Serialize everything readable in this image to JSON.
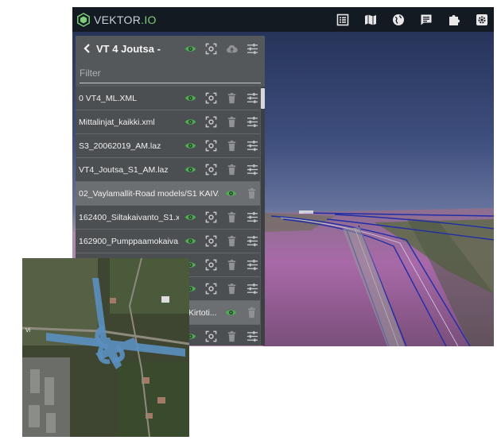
{
  "app": {
    "brand": {
      "name": "VEKTOR",
      "suffix": ".IO"
    },
    "top_icons": [
      "table-icon",
      "map-icon",
      "globe-icon",
      "notes-icon",
      "puzzle-icon",
      "settings-icon"
    ]
  },
  "panel": {
    "title": "VT 4 Joutsa -",
    "header_icons": [
      "eye-icon",
      "focus-icon",
      "cloud-upload-icon",
      "sliders-icon"
    ],
    "filter_placeholder": "Filter",
    "layers": [
      {
        "label": "0 VT4_ML.XML",
        "icons": [
          "eye-icon",
          "focus-icon",
          "trash-icon",
          "sliders-icon"
        ],
        "selected": false
      },
      {
        "label": "Mittalinjat_kaikki.xml",
        "icons": [
          "eye-icon",
          "focus-icon",
          "trash-icon",
          "sliders-icon"
        ],
        "selected": false
      },
      {
        "label": "S3_20062019_AM.laz",
        "icons": [
          "eye-icon",
          "focus-icon",
          "trash-icon",
          "sliders-icon"
        ],
        "selected": false
      },
      {
        "label": "VT4_Joutsa_S1_AM.laz",
        "icons": [
          "eye-icon",
          "focus-icon",
          "trash-icon",
          "sliders-icon"
        ],
        "selected": false
      },
      {
        "label": "02_Vaylamallit-Road models/S1 KAIV...",
        "icons": [
          "eye-icon",
          "trash-icon"
        ],
        "selected": true
      },
      {
        "label": "162400_Siltakaivanto_S1.x...",
        "icons": [
          "eye-icon",
          "focus-icon",
          "trash-icon",
          "sliders-icon"
        ],
        "selected": false
      },
      {
        "label": "162900_Pumppaamokaiva...",
        "icons": [
          "eye-icon",
          "focus-icon",
          "trash-icon",
          "sliders-icon"
        ],
        "selected": false
      },
      {
        "label": "",
        "icons": [
          "eye-icon",
          "focus-icon",
          "trash-icon",
          "sliders-icon"
        ],
        "selected": false
      },
      {
        "label": "",
        "icons": [
          "eye-icon",
          "focus-icon",
          "trash-icon",
          "sliders-icon"
        ],
        "selected": false
      },
      {
        "label": "Kirtoti...",
        "icons": [
          "eye-icon",
          "trash-icon"
        ],
        "selected": true
      },
      {
        "label": "",
        "icons": [
          "eye-icon",
          "focus-icon",
          "trash-icon",
          "sliders-icon"
        ],
        "selected": false
      }
    ]
  },
  "satellite": {
    "road_label": "Vi"
  },
  "colors": {
    "accent_green": "#4caf50",
    "icon_grey": "#b5b7b9",
    "topbar": "#141a22",
    "panel": "#55585b",
    "road_blue": "#5b8fbf"
  }
}
